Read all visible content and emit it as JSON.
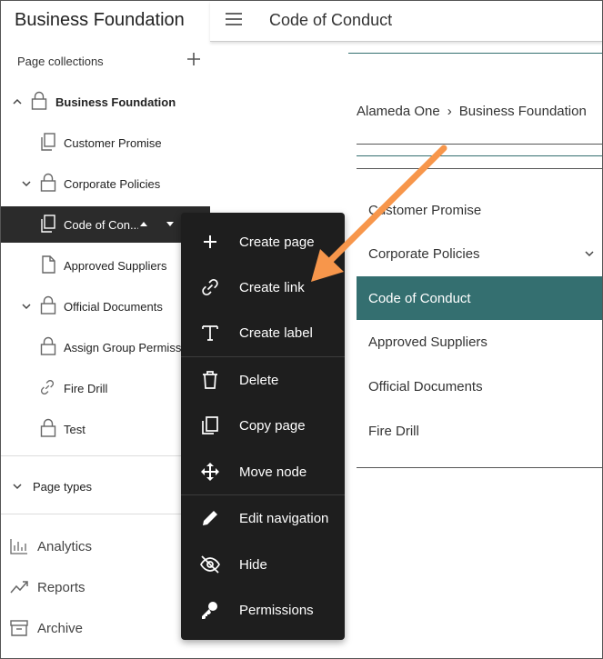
{
  "app": {
    "title": "Business Foundation"
  },
  "header": {
    "page_title": "Code of Conduct"
  },
  "sidebar": {
    "collections_label": "Page collections",
    "tree": [
      {
        "label": "Business Foundation"
      },
      {
        "label": "Customer Promise"
      },
      {
        "label": "Corporate Policies"
      },
      {
        "label": "Code of Con..."
      },
      {
        "label": "Approved Suppliers"
      },
      {
        "label": "Official Documents"
      },
      {
        "label": "Assign Group Permissions"
      },
      {
        "label": "Fire Drill"
      },
      {
        "label": "Test"
      }
    ],
    "page_types_label": "Page types",
    "nav": [
      {
        "label": "Analytics"
      },
      {
        "label": "Reports"
      },
      {
        "label": "Archive"
      }
    ]
  },
  "preview": {
    "breadcrumb": [
      "Alameda One",
      "Business Foundation"
    ],
    "breadcrumb_sep": "›",
    "items": [
      {
        "label": "Customer Promise"
      },
      {
        "label": "Corporate Policies"
      },
      {
        "label": "Code of Conduct"
      },
      {
        "label": "Approved Suppliers"
      },
      {
        "label": "Official Documents"
      },
      {
        "label": "Fire Drill"
      }
    ]
  },
  "context_menu": {
    "items": [
      {
        "label": "Create page",
        "icon": "plus-icon"
      },
      {
        "label": "Create link",
        "icon": "link-icon"
      },
      {
        "label": "Create label",
        "icon": "text-icon"
      },
      {
        "label": "Delete",
        "icon": "trash-icon"
      },
      {
        "label": "Copy page",
        "icon": "copy-icon"
      },
      {
        "label": "Move node",
        "icon": "move-icon"
      },
      {
        "label": "Edit navigation",
        "icon": "pencil-icon"
      },
      {
        "label": "Hide",
        "icon": "eye-off-icon"
      },
      {
        "label": "Permissions",
        "icon": "key-icon"
      }
    ]
  },
  "colors": {
    "accent": "#346f70",
    "menu_bg": "#1e1e1e",
    "selected_bg": "#2b2b2b",
    "annotation_arrow": "#f7964b"
  }
}
